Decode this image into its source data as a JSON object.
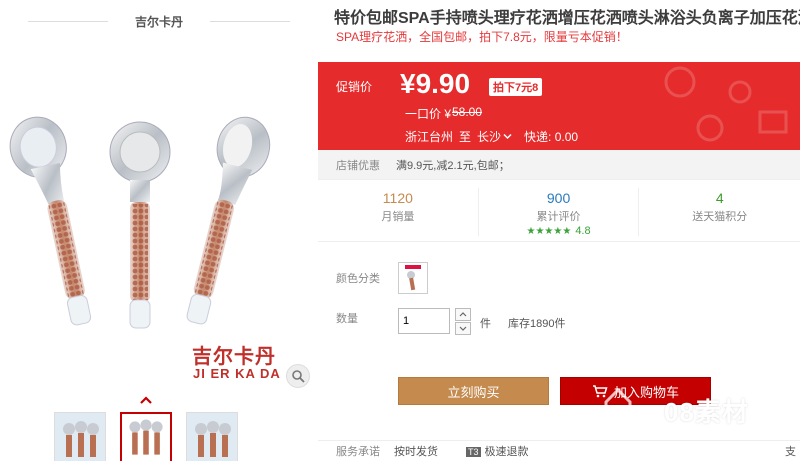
{
  "gallery": {
    "brand_title": "吉尔卡丹",
    "logo_cn": "吉尔卡丹",
    "logo_en": "JI ER KA DA",
    "icons": {
      "zoom": "magnifier-icon",
      "up": "chevron-up-icon"
    },
    "thumbnail_count": 3
  },
  "product": {
    "title": "特价包邮SPA手持喷头理疗花洒增压花洒喷头淋浴头负离子加压花洒",
    "subtitle": "SPA理疗花洒，全国包邮，拍下7.8元，限量亏本促销！"
  },
  "price": {
    "label": "促销价",
    "value": "¥9.90",
    "discount": "拍下7元",
    "discount_suffix": "8",
    "orig_label": "一口价 ¥",
    "orig_value": "58.00",
    "ship_from": "浙江台州",
    "ship_to_prefix": "至",
    "ship_to": "长沙",
    "shipping_fee": "快递: 0.00"
  },
  "promo": {
    "label": "店铺优惠",
    "text": "满9.9元,减2.1元,包邮；"
  },
  "stats": [
    {
      "num": "1120",
      "label": "月销量"
    },
    {
      "num": "900",
      "label": "累计评价",
      "stars": "★★★★★",
      "score": "4.8"
    },
    {
      "num": "4",
      "label": "送天猫积分"
    }
  ],
  "options": {
    "color_label": "颜色分类",
    "qty_label": "数量",
    "qty_value": "1",
    "unit": "件",
    "stock": "库存1890件"
  },
  "actions": {
    "buy_now": "立刻购买",
    "add_cart": "加入购物车"
  },
  "service": {
    "label": "服务承诺",
    "item1": "按时发货",
    "badge": "T3",
    "item2": "极速退款",
    "more": "支"
  },
  "watermark": "08素材",
  "colors": {
    "price_red": "#e52b2b",
    "buy_now": "#c48a4e",
    "add_cart": "#c40000"
  }
}
